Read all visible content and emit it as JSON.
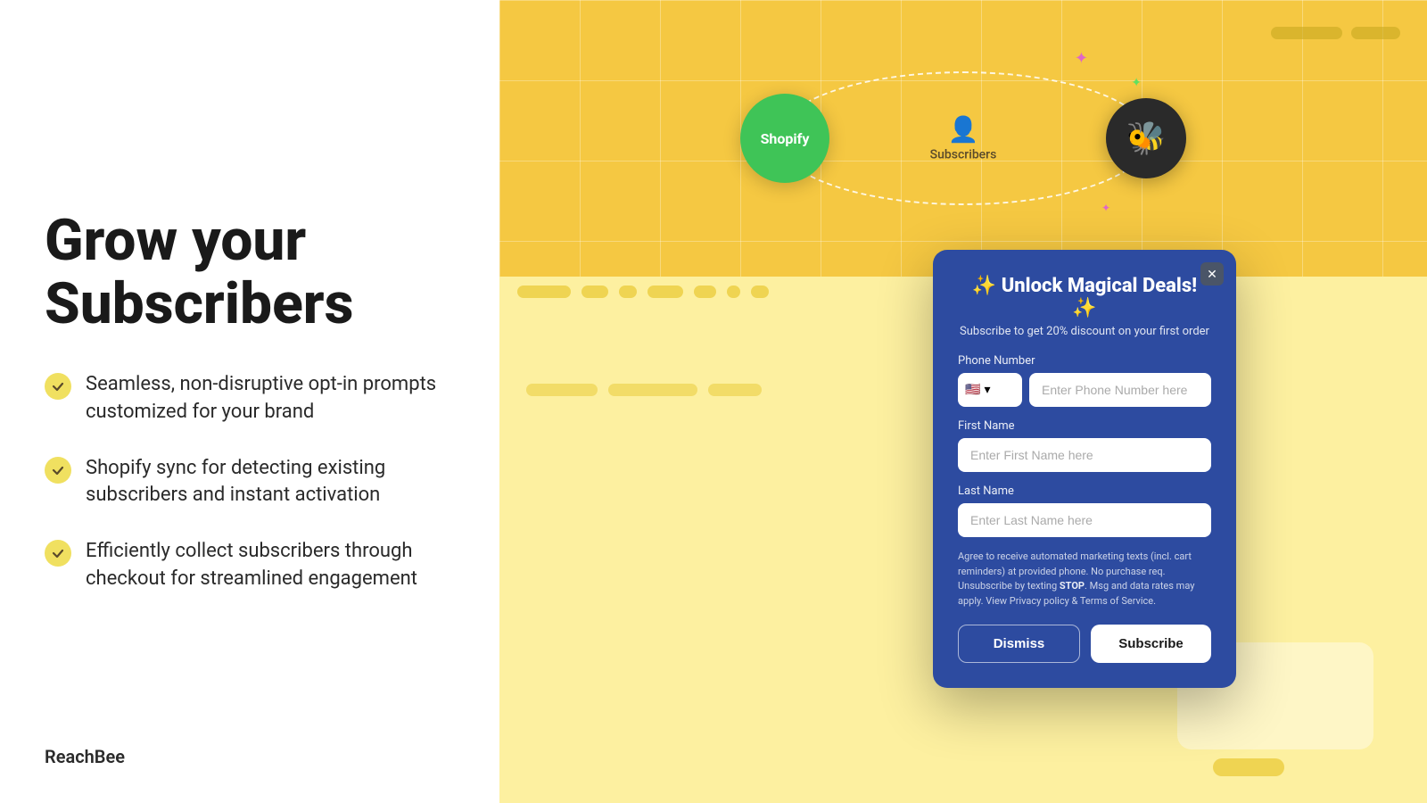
{
  "left": {
    "title_line1": "Grow your",
    "title_line2": "Subscribers",
    "features": [
      {
        "id": "feature-1",
        "text": "Seamless, non-disruptive opt-in prompts customized for your brand"
      },
      {
        "id": "feature-2",
        "text": "Shopify sync for detecting existing subscribers and instant activation"
      },
      {
        "id": "feature-3",
        "text": "Efficiently collect subscribers through checkout for streamlined engagement"
      }
    ],
    "brand": "ReachBee"
  },
  "diagram": {
    "shopify_label": "Shopify",
    "subscribers_label": "Subscribers",
    "sparkle1": "✦",
    "sparkle2": "✦",
    "sparkle3": "✦"
  },
  "modal": {
    "title": "✨ Unlock Magical Deals! ✨",
    "subtitle": "Subscribe to get 20% discount on your first order",
    "phone_label": "Phone Number",
    "phone_placeholder": "Enter Phone Number here",
    "first_name_label": "First Name",
    "first_name_placeholder": "Enter First Name here",
    "last_name_label": "Last Name",
    "last_name_placeholder": "Enter Last Name here",
    "consent_text": "Agree to receive automated marketing texts (incl. cart reminders) at provided phone. No purchase req. Unsubscribe by texting ",
    "consent_stop": "STOP",
    "consent_text2": ". Msg and data rates may apply. View Privacy policy & Terms of Service.",
    "dismiss_label": "Dismiss",
    "subscribe_label": "Subscribe",
    "country_flag": "🇺🇸",
    "country_code": "▾"
  }
}
